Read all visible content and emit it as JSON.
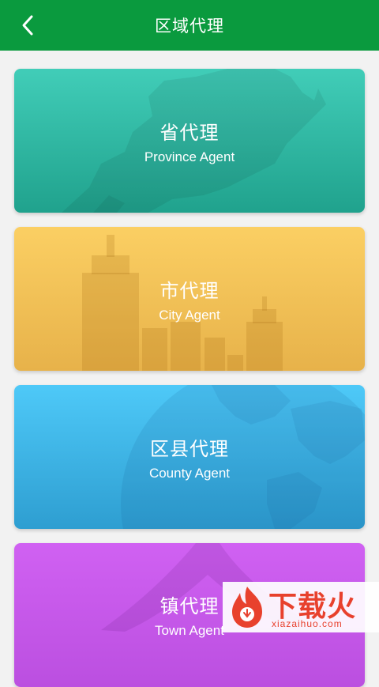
{
  "header": {
    "title": "区域代理",
    "back_icon": "chevron-left-icon"
  },
  "cards": [
    {
      "name_cn": "省代理",
      "name_en": "Province Agent",
      "color": "#2fb8a2"
    },
    {
      "name_cn": "市代理",
      "name_en": "City Agent",
      "color": "#f2c056"
    },
    {
      "name_cn": "区县代理",
      "name_en": "County Agent",
      "color": "#3db4e5"
    },
    {
      "name_cn": "镇代理",
      "name_en": "Town Agent",
      "color": "#c759ea"
    }
  ],
  "watermark": {
    "text": "下载火",
    "url": "xiazaihuo.com"
  }
}
